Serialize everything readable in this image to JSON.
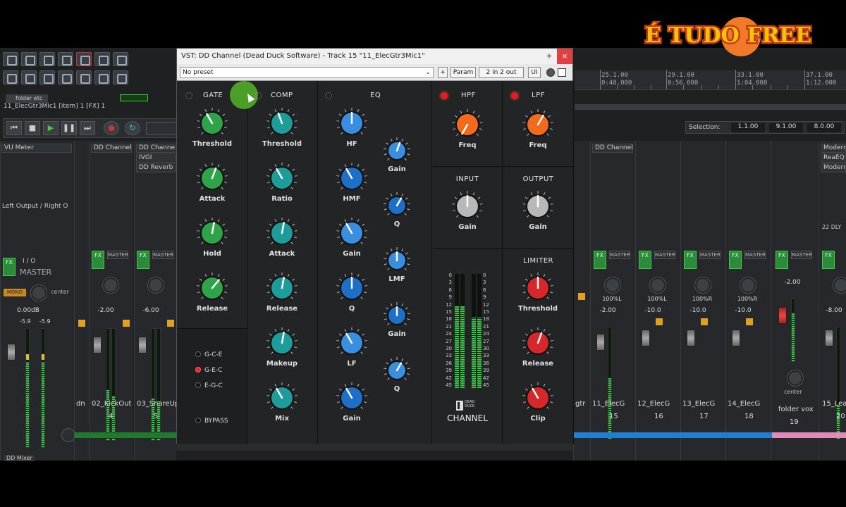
{
  "window": {
    "title": "VST: DD Channel (Dead Duck Software) - Track 15 \"11_ElecGtr3Mic1\"",
    "preset": "No preset",
    "param_button": "Param",
    "io_button": "2 in 2 out",
    "ui_button": "UI",
    "controls": [
      "+",
      "×"
    ]
  },
  "watermark": {
    "text": "É TUDO FREE",
    "colors": {
      "fill": "#f5c400",
      "outline": "#c43a1e",
      "peach": "#f07a28"
    }
  },
  "colors": {
    "green_knob": "#2fa34a",
    "comp_knob": "#1e9c9a",
    "eq_knob": "#3a8ee0",
    "eq_knob_dark": "#1e6fc7",
    "hpf_knob": "#f26a1b",
    "gray_knob": "#b8b8b8",
    "red_knob": "#d6282b",
    "led_red": "#e02020"
  },
  "plugin": {
    "gate": {
      "title": "GATE",
      "knobs": [
        "Threshold",
        "Attack",
        "Hold",
        "Release"
      ],
      "modes": [
        "G-C-E",
        "G-E-C",
        "E-G-C"
      ],
      "selected_mode": 1,
      "bypass": "BYPASS"
    },
    "comp": {
      "title": "COMP",
      "knobs": [
        "Threshold",
        "Ratio",
        "Attack",
        "Release",
        "Makeup",
        "Mix"
      ]
    },
    "eq": {
      "title": "EQ",
      "left_knobs": [
        "HF",
        "HMF",
        "Gain",
        "Q",
        "LF",
        "Gain"
      ],
      "right_knobs": [
        "Gain",
        "Q",
        "LMF",
        "Gain",
        "Q"
      ]
    },
    "hpf": {
      "title": "HPF",
      "knob": "Freq"
    },
    "lpf": {
      "title": "LPF",
      "knob": "Freq"
    },
    "input": {
      "title": "INPUT",
      "knob": "Gain"
    },
    "output": {
      "title": "OUTPUT",
      "knob": "Gain"
    },
    "limiter": {
      "title": "LIMITER",
      "knobs": [
        "Threshold",
        "Release",
        "Clip"
      ]
    },
    "meter_scale": [
      "0",
      "3",
      "6",
      "9",
      "12",
      "15",
      "18",
      "21",
      "24",
      "27",
      "30",
      "33",
      "36",
      "39",
      "42",
      "45"
    ],
    "brand": {
      "line1": "DEAD DUCK",
      "line2": "CHANNEL"
    }
  },
  "daw": {
    "folder": "folder etc",
    "track_label": "11_ElecGtr3Mic1 [item] 1 [FX] 1",
    "master_fx": [
      "VU Meter",
      "Left Output / Right O"
    ],
    "fx_left": [
      "DD Channel",
      "DD Channel",
      "IVGI",
      "DD Reverb"
    ],
    "master_label": "MASTER",
    "mono_label": "MONO",
    "center_label": "center",
    "io_label": "I / O",
    "io_master": "MASTER",
    "master_db": "0.00dB",
    "master_meter": [
      "-5.9",
      "-5.9"
    ],
    "left_tracks": [
      {
        "name": "dn",
        "num": ""
      },
      {
        "name": "02_KickOut",
        "num": "4",
        "vol": "-2.00"
      },
      {
        "name": "03_SnareUp",
        "num": "5",
        "vol": "-6.00"
      }
    ],
    "right_fx": [
      "DD Channel"
    ],
    "right_tracks": [
      {
        "name": "gtr",
        "num": ""
      },
      {
        "name": "11_ElecG",
        "num": "15",
        "vol": "-2.00",
        "pan": "100%L"
      },
      {
        "name": "12_ElecG",
        "num": "16",
        "vol": "-10.0",
        "pan": "100%L"
      },
      {
        "name": "13_ElecG",
        "num": "17",
        "vol": "-10.0",
        "pan": "100%R"
      },
      {
        "name": "14_ElecG",
        "num": "18",
        "vol": "-10.0",
        "pan": "100%R"
      },
      {
        "name": "folder vox",
        "num": "19",
        "vol": "-2.00"
      },
      {
        "name": "15_Lea",
        "num": "20",
        "vol": "-8.00"
      }
    ],
    "right_edge_fx": [
      "Modern",
      "ReaEQ",
      "Modern",
      "22 DLY"
    ],
    "selection_label": "Selection:",
    "selection": [
      "1.1.00",
      "9.1.00",
      "8.0.00"
    ],
    "ruler": [
      [
        "25.1.00",
        "0:48.000"
      ],
      [
        "29.1.00",
        "0:56.000"
      ],
      [
        "33.1.00",
        "1:04.000"
      ],
      [
        "37.1.00",
        "1:12.000"
      ]
    ],
    "mixer_tab": "DD Mixer"
  }
}
